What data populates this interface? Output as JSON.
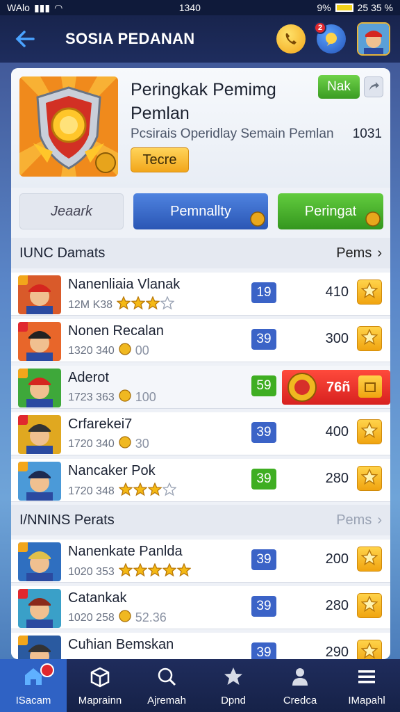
{
  "status_bar": {
    "carrier": "WAlo",
    "time": "1340",
    "battery_pct": "9%",
    "extra": "25 35 %"
  },
  "header": {
    "title": "SOSIA PEDANAN",
    "notif_count": "2"
  },
  "hero": {
    "title": "Peringkak Pemimg Pemlan",
    "subtitle": "Pcsirais Operidlay Semain Pemlan",
    "count": "1031",
    "button_label": "Tecre",
    "next_label": "Nak"
  },
  "tabs": [
    {
      "label": "Jeaark"
    },
    {
      "label": "Pemnallty"
    },
    {
      "label": "Peringat"
    }
  ],
  "section1": {
    "title": "IUNC Damats",
    "more": "Pems"
  },
  "section2": {
    "title": "I/NNINS Perats",
    "more": "Pems"
  },
  "rows1": [
    {
      "name": "Nanenliaia Vlanak",
      "meta": "12M K38",
      "meta_value": "",
      "rating": 3,
      "rating_out_of": 4,
      "level": "19",
      "level_color": "blue",
      "score": "410"
    },
    {
      "name": "Nonen Recalan",
      "meta": "1320 340",
      "meta_value": "00",
      "level": "39",
      "level_color": "blue",
      "score": "300"
    },
    {
      "name": "Aderot",
      "meta": "1723 363",
      "meta_value": "100",
      "level": "59",
      "level_color": "green",
      "highlight": "76ñ"
    },
    {
      "name": "Crfarekei7",
      "meta": "1720 340",
      "meta_value": "30",
      "level": "39",
      "level_color": "blue",
      "score": "400"
    },
    {
      "name": "Nancaker Pok",
      "meta": "1720 348",
      "meta_value": "",
      "rating": 3,
      "rating_out_of": 4,
      "level": "39",
      "level_color": "green",
      "score": "280"
    }
  ],
  "rows2": [
    {
      "name": "Nanenkate Panlda",
      "meta": "1020 353",
      "meta_value": "",
      "rating": 5,
      "rating_out_of": 5,
      "level": "39",
      "level_color": "blue",
      "score": "200"
    },
    {
      "name": "Catankak",
      "meta": "1020 258",
      "meta_value": "52.36",
      "level": "39",
      "level_color": "blue",
      "score": "280"
    },
    {
      "name": "Cuћian Bemskan",
      "meta": "",
      "meta_value": "",
      "level": "39",
      "level_color": "blue",
      "score": "290"
    }
  ],
  "nav": [
    {
      "label": "ISacam",
      "icon": "home-icon",
      "active": true
    },
    {
      "label": "Maprainn",
      "icon": "box-icon"
    },
    {
      "label": "Ajremah",
      "icon": "search-person-icon"
    },
    {
      "label": "Dpnd",
      "icon": "star-icon"
    },
    {
      "label": "Credca",
      "icon": "person-icon"
    },
    {
      "label": "IMapahl",
      "icon": "menu-icon"
    }
  ],
  "colors": {
    "accent_blue": "#2f62c4",
    "accent_green": "#3fae22",
    "accent_gold": "#f2a61b",
    "accent_red": "#e0282e"
  }
}
